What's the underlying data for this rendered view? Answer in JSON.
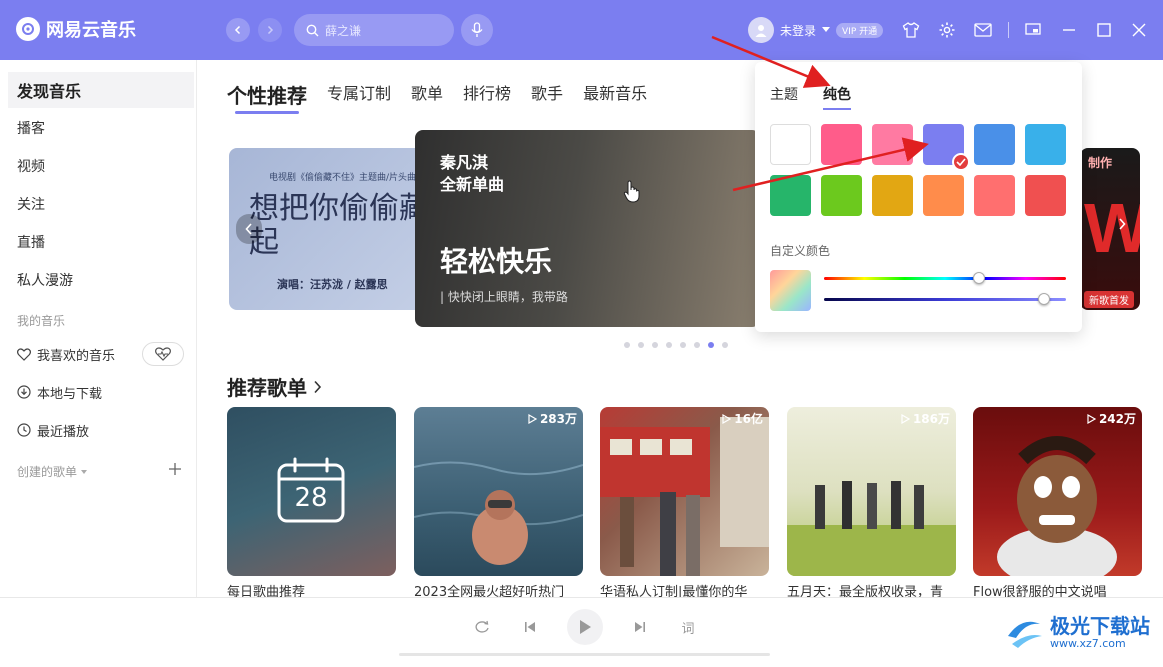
{
  "app": {
    "title": "网易云音乐"
  },
  "search": {
    "placeholder": "薛之谦"
  },
  "user": {
    "name": "未登录",
    "vip_badge": "开通"
  },
  "sidebar": {
    "items": [
      {
        "label": "发现音乐"
      },
      {
        "label": "播客"
      },
      {
        "label": "视频"
      },
      {
        "label": "关注"
      },
      {
        "label": "直播"
      },
      {
        "label": "私人漫游"
      }
    ],
    "my_music_header": "我的音乐",
    "my_items": [
      {
        "label": "我喜欢的音乐"
      },
      {
        "label": "本地与下载"
      },
      {
        "label": "最近播放"
      }
    ],
    "created_header": "创建的歌单"
  },
  "main": {
    "tabs": [
      {
        "label": "个性推荐"
      },
      {
        "label": "专属订制"
      },
      {
        "label": "歌单"
      },
      {
        "label": "排行榜"
      },
      {
        "label": "歌手"
      },
      {
        "label": "最新音乐"
      }
    ],
    "banner_left": {
      "caption": "电视剧《偷偷藏不住》主题曲/片头曲",
      "title": "想把你偷偷藏起",
      "credit": "演唱：汪苏泷 / 赵露思"
    },
    "banner_main": {
      "line1": "秦凡淇",
      "line2": "全新单曲",
      "headline": "轻松快乐",
      "tagline": "| 快快闭上眼睛，我带路"
    },
    "banner_right": {
      "top_text": "制作",
      "letter": "W",
      "tag": "新歌首发"
    },
    "section_title": "推荐歌单",
    "daily_date": "28",
    "cards": [
      {
        "title": "每日歌曲推荐",
        "plays": ""
      },
      {
        "title": "2023全网最火超好听热门",
        "plays": "283万"
      },
      {
        "title": "华语私人订制|最懂你的华",
        "plays": "16亿"
      },
      {
        "title": "五月天：最全版权收录，青",
        "plays": "186万"
      },
      {
        "title": "Flow很舒服的中文说唱",
        "plays": "242万"
      }
    ]
  },
  "player": {
    "lyrics_label": "词"
  },
  "theme_popover": {
    "tabs": [
      {
        "label": "主题"
      },
      {
        "label": "纯色"
      }
    ],
    "active_tab": "纯色",
    "swatches": [
      "#ffffff",
      "#ff5c8a",
      "#ff7aa2",
      "#7b7ef0",
      "#4a90e8",
      "#39b0ea",
      "#26b56a",
      "#6cc91e",
      "#e2a713",
      "#ff8c4b",
      "#ff6f6f",
      "#f05050"
    ],
    "selected_swatch": "#7b7ef0",
    "custom_label": "自定义颜色",
    "hue_level": 0.64,
    "shade_level": 0.91
  },
  "watermark": {
    "name": "极光下载站",
    "url": "www.xz7.com"
  },
  "colors": {
    "accent": "#7b7ef0",
    "annotation_arrow": "#e02020"
  }
}
